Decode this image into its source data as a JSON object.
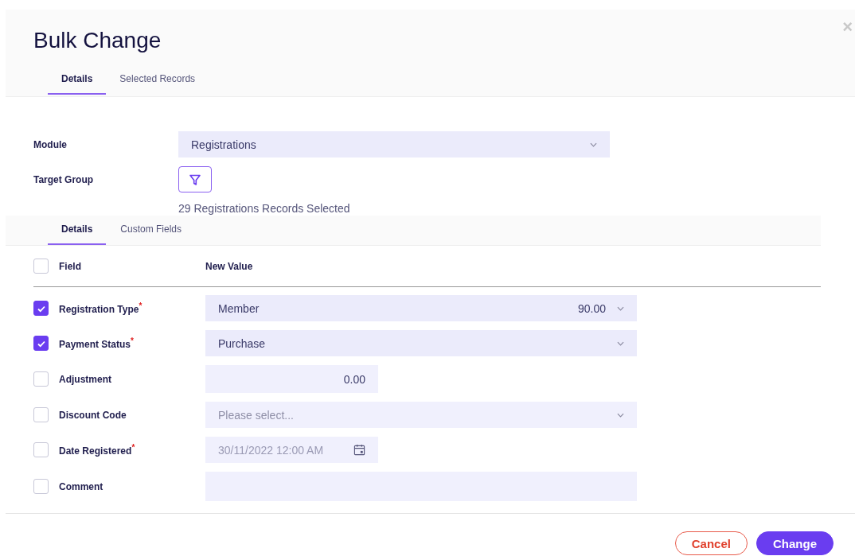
{
  "dialog": {
    "title": "Bulk Change",
    "close": "×"
  },
  "tabs": [
    {
      "label": "Details",
      "selected": true
    },
    {
      "label": "Selected Records",
      "selected": false
    }
  ],
  "module": {
    "label": "Module",
    "value": "Registrations"
  },
  "target_group": {
    "label": "Target Group",
    "summary": "29 Registrations Records Selected"
  },
  "subtabs": [
    {
      "label": "Details",
      "selected": true
    },
    {
      "label": "Custom Fields",
      "selected": false
    }
  ],
  "table": {
    "checked": false,
    "columns": [
      "Field",
      "New Value"
    ],
    "rows": [
      {
        "label": "Registration Type",
        "required_mark": "*",
        "checked": true,
        "kind": "select",
        "value": "Member",
        "amount": "90.00"
      },
      {
        "label": "Payment Status",
        "required_mark": "*",
        "checked": true,
        "kind": "select",
        "value": "Purchase"
      },
      {
        "label": "Adjustment",
        "checked": false,
        "kind": "number",
        "value": "0.00"
      },
      {
        "label": "Discount Code",
        "checked": false,
        "kind": "select",
        "placeholder": "Please select..."
      },
      {
        "label": "Date Registered",
        "required_mark": "*",
        "checked": false,
        "kind": "date",
        "disabled": true,
        "value": "30/11/2022 12:00 AM"
      },
      {
        "label": "Comment",
        "checked": false,
        "kind": "text"
      }
    ]
  },
  "buttons": [
    {
      "label": "Cancel",
      "kind": "secondary"
    },
    {
      "label": "Change",
      "kind": "primary"
    }
  ]
}
